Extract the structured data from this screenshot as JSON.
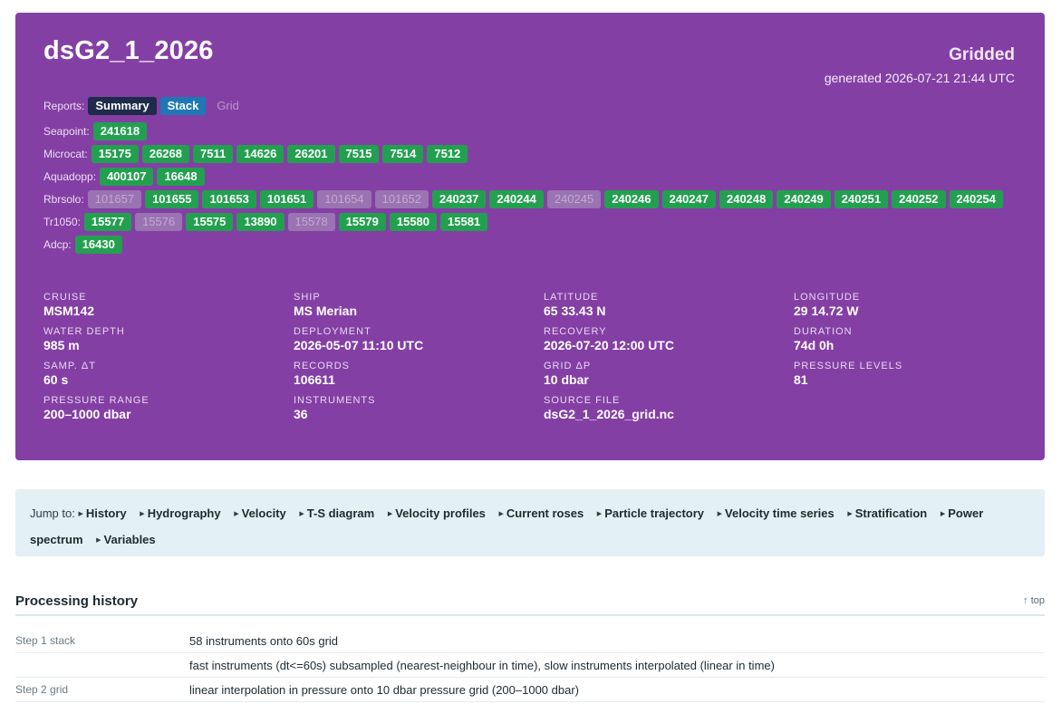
{
  "header": {
    "title": "dsG2_1_2026",
    "kind": "Gridded",
    "generated": "generated 2026-07-21 21:44 UTC"
  },
  "reports": {
    "label": "Reports:",
    "summary": "Summary",
    "stack": "Stack",
    "grid": "Grid"
  },
  "instruments": [
    {
      "label": "Seapoint:",
      "ids": [
        {
          "id": "241618",
          "on": true
        }
      ]
    },
    {
      "label": "Microcat:",
      "ids": [
        {
          "id": "15175",
          "on": true
        },
        {
          "id": "26268",
          "on": true
        },
        {
          "id": "7511",
          "on": true
        },
        {
          "id": "14626",
          "on": true
        },
        {
          "id": "26201",
          "on": true
        },
        {
          "id": "7515",
          "on": true
        },
        {
          "id": "7514",
          "on": true
        },
        {
          "id": "7512",
          "on": true
        }
      ]
    },
    {
      "label": "Aquadopp:",
      "ids": [
        {
          "id": "400107",
          "on": true
        },
        {
          "id": "16648",
          "on": true
        }
      ]
    },
    {
      "label": "Rbrsolo:",
      "ids": [
        {
          "id": "101657",
          "on": false
        },
        {
          "id": "101655",
          "on": true
        },
        {
          "id": "101653",
          "on": true
        },
        {
          "id": "101651",
          "on": true
        },
        {
          "id": "101654",
          "on": false
        },
        {
          "id": "101652",
          "on": false
        },
        {
          "id": "240237",
          "on": true
        },
        {
          "id": "240244",
          "on": true
        },
        {
          "id": "240245",
          "on": false
        },
        {
          "id": "240246",
          "on": true
        },
        {
          "id": "240247",
          "on": true
        },
        {
          "id": "240248",
          "on": true
        },
        {
          "id": "240249",
          "on": true
        },
        {
          "id": "240251",
          "on": true
        },
        {
          "id": "240252",
          "on": true
        },
        {
          "id": "240254",
          "on": true
        }
      ]
    },
    {
      "label": "Tr1050:",
      "ids": [
        {
          "id": "15577",
          "on": true
        },
        {
          "id": "15576",
          "on": false
        },
        {
          "id": "15575",
          "on": true
        },
        {
          "id": "13890",
          "on": true
        },
        {
          "id": "15578",
          "on": false
        },
        {
          "id": "15579",
          "on": true
        },
        {
          "id": "15580",
          "on": true
        },
        {
          "id": "15581",
          "on": true
        }
      ]
    },
    {
      "label": "Adcp:",
      "ids": [
        {
          "id": "16430",
          "on": true
        }
      ]
    }
  ],
  "meta": [
    {
      "k": "CRUISE",
      "v": "MSM142"
    },
    {
      "k": "SHIP",
      "v": "MS Merian"
    },
    {
      "k": "LATITUDE",
      "v": "65 33.43 N"
    },
    {
      "k": "LONGITUDE",
      "v": "29 14.72 W"
    },
    {
      "k": "WATER DEPTH",
      "v": "985 m"
    },
    {
      "k": "DEPLOYMENT",
      "v": "2026-05-07 11:10 UTC"
    },
    {
      "k": "RECOVERY",
      "v": "2026-07-20 12:00 UTC"
    },
    {
      "k": "DURATION",
      "v": "74d 0h"
    },
    {
      "k": "SAMP. ΔT",
      "v": "60 s"
    },
    {
      "k": "RECORDS",
      "v": "106611"
    },
    {
      "k": "GRID ΔP",
      "v": "10 dbar"
    },
    {
      "k": "PRESSURE LEVELS",
      "v": "81"
    },
    {
      "k": "PRESSURE RANGE",
      "v": "200–1000 dbar"
    },
    {
      "k": "INSTRUMENTS",
      "v": "36"
    },
    {
      "k": "SOURCE FILE",
      "v": "dsG2_1_2026_grid.nc"
    }
  ],
  "jump": {
    "label": "Jump to:",
    "links": [
      "History",
      "Hydrography",
      "Velocity",
      "T-S diagram",
      "Velocity profiles",
      "Current roses",
      "Particle trajectory",
      "Velocity time series",
      "Stratification",
      "Power spectrum",
      "Variables"
    ]
  },
  "history": {
    "title": "Processing history",
    "top": "↑ top",
    "rows": [
      {
        "step": "Step 1 stack",
        "desc": "58 instruments onto 60s grid"
      },
      {
        "step": "",
        "desc": "fast instruments (dt<=60s) subsampled (nearest-neighbour in time), slow instruments interpolated (linear in time)"
      },
      {
        "step": "Step 2 grid",
        "desc": "linear interpolation in pressure onto 10 dbar pressure grid (200–1000 dbar)"
      }
    ]
  }
}
